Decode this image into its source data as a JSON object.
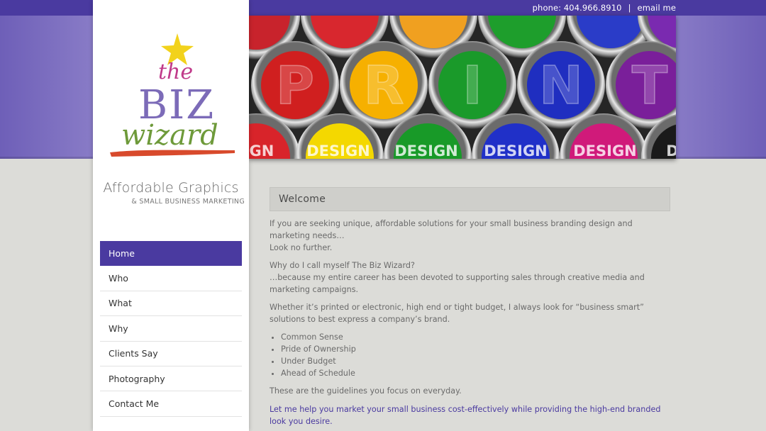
{
  "topbar": {
    "phone": "phone: 404.966.8910",
    "separator": "|",
    "email_label": "email me"
  },
  "colors": {
    "brand_purple": "#4a3aa0",
    "band_purple": "#9a8ed0",
    "page_bg": "#dcdcd8"
  },
  "banner": {
    "letters": [
      "P",
      "R",
      "I",
      "N",
      "T"
    ],
    "design_word": "DESIGN",
    "partial_left": "IGN",
    "partial_right": "D"
  },
  "logo": {
    "the": "the",
    "biz": "BIZ",
    "wizard": "wizard",
    "icon": "star-icon"
  },
  "tagline": {
    "line1": "Affordable Graphics",
    "line2": "& small business marketing"
  },
  "nav": {
    "items": [
      {
        "label": "Home"
      },
      {
        "label": "Who"
      },
      {
        "label": "What"
      },
      {
        "label": "Why"
      },
      {
        "label": "Clients Say"
      },
      {
        "label": "Photography"
      },
      {
        "label": "Contact Me"
      }
    ]
  },
  "main": {
    "heading": "Welcome",
    "p1": "If you are seeking unique, affordable solutions for your small business branding design and marketing needs…",
    "p1b": "Look no further.",
    "p2": "Why do I call myself The Biz Wizard?",
    "p2b": "…because my entire career has been devoted to supporting sales through creative media and marketing campaigns.",
    "p3": "Whether it’s printed or electronic, high end or tight budget, I always look for “business smart” solutions to best express a company’s brand.",
    "bullets": [
      "Common Sense",
      "Pride of Ownership",
      "Under Budget",
      "Ahead of Schedule"
    ],
    "p4": "These are the guidelines you focus on everyday.",
    "p5": "Let me help you market your small business cost-effectively while providing the high-end branded look you desire."
  }
}
